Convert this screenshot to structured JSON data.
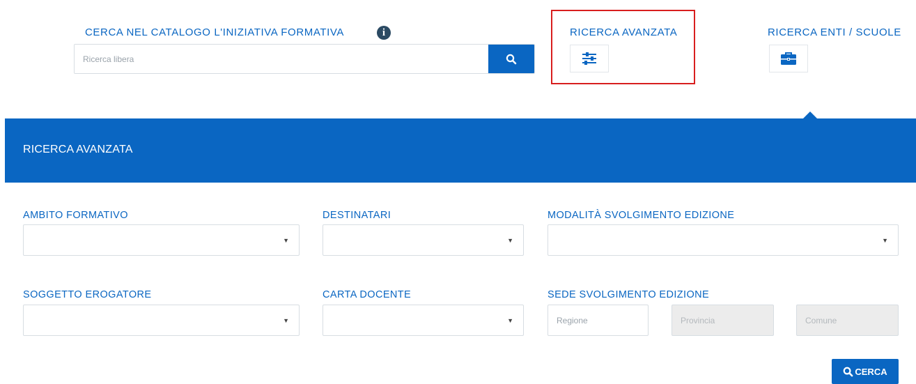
{
  "search": {
    "label": "CERCA NEL CATALOGO L'INIZIATIVA FORMATIVA",
    "placeholder": "Ricerca libera",
    "info_icon": "info-icon",
    "button_icon": "search-icon"
  },
  "nav": {
    "advanced_label": "RICERCA AVANZATA",
    "advanced_icon": "sliders-icon",
    "entities_label": "RICERCA ENTI / SCUOLE",
    "entities_icon": "briefcase-icon"
  },
  "panel": {
    "title": "RICERCA AVANZATA"
  },
  "form": {
    "ambito_label": "AMBITO FORMATIVO",
    "destinatari_label": "DESTINATARI",
    "modalita_label": "MODALITÀ SVOLGIMENTO EDIZIONE",
    "soggetto_label": "SOGGETTO EROGATORE",
    "carta_label": "CARTA DOCENTE",
    "sede_label": "SEDE SVOLGIMENTO EDIZIONE",
    "regione_placeholder": "Regione",
    "provincia_placeholder": "Provincia",
    "comune_placeholder": "Comune",
    "submit_label": "CERCA"
  },
  "colors": {
    "accent": "#0a66c2",
    "highlight": "#d81e1e"
  }
}
